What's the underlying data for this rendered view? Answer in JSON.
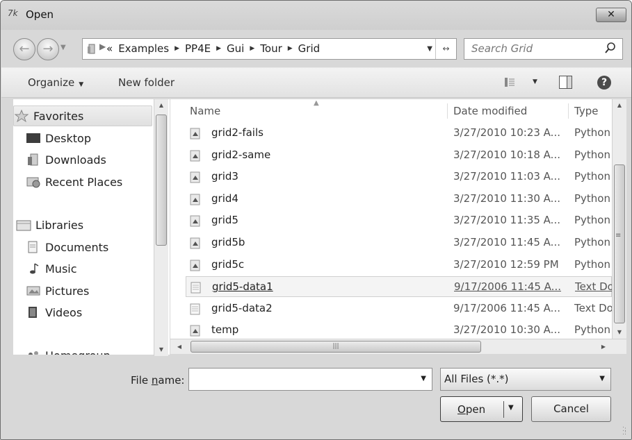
{
  "window": {
    "title": "Open",
    "close_label": "✕"
  },
  "address": {
    "overflow": "«",
    "crumbs": [
      "Examples",
      "PP4E",
      "Gui",
      "Tour",
      "Grid"
    ]
  },
  "search": {
    "placeholder": "Search Grid"
  },
  "toolbar": {
    "organize_label": "Organize",
    "new_folder_label": "New folder"
  },
  "nav": {
    "favorites": "Favorites",
    "desktop": "Desktop",
    "downloads": "Downloads",
    "recent": "Recent Places",
    "libraries": "Libraries",
    "documents": "Documents",
    "music": "Music",
    "pictures": "Pictures",
    "videos": "Videos",
    "homegroup": "Homegroup"
  },
  "columns": {
    "name": "Name",
    "date": "Date modified",
    "type": "Type"
  },
  "files": [
    {
      "name": "grid2-fails",
      "date": "3/27/2010 10:23 A...",
      "type": "Python",
      "icon": "python-file-icon"
    },
    {
      "name": "grid2-same",
      "date": "3/27/2010 10:18 A...",
      "type": "Python",
      "icon": "python-file-icon"
    },
    {
      "name": "grid3",
      "date": "3/27/2010 11:03 A...",
      "type": "Python",
      "icon": "python-file-icon"
    },
    {
      "name": "grid4",
      "date": "3/27/2010 11:30 A...",
      "type": "Python",
      "icon": "python-file-icon"
    },
    {
      "name": "grid5",
      "date": "3/27/2010 11:35 A...",
      "type": "Python",
      "icon": "python-file-icon"
    },
    {
      "name": "grid5b",
      "date": "3/27/2010 11:45 A...",
      "type": "Python",
      "icon": "python-file-icon"
    },
    {
      "name": "grid5c",
      "date": "3/27/2010 12:59 PM",
      "type": "Python",
      "icon": "python-file-icon"
    },
    {
      "name": "grid5-data1",
      "date": "9/17/2006 11:45 A...",
      "type": "Text Do",
      "icon": "text-file-icon",
      "selected": true
    },
    {
      "name": "grid5-data2",
      "date": "9/17/2006 11:45 A...",
      "type": "Text Do",
      "icon": "text-file-icon"
    },
    {
      "name": "temp",
      "date": "3/27/2010 10:30 A...",
      "type": "Python",
      "icon": "python-file-icon"
    }
  ],
  "bottom": {
    "file_name_label_pre": "File ",
    "file_name_label_u": "n",
    "file_name_label_post": "ame:",
    "file_name_value": "",
    "filter_value": "All Files (*.*)",
    "open_label_u": "O",
    "open_label_rest": "pen",
    "cancel_label": "Cancel"
  },
  "colors": {
    "window_bg": "#d8d8d8",
    "pane_bg": "#ffffff",
    "text": "#222222"
  }
}
